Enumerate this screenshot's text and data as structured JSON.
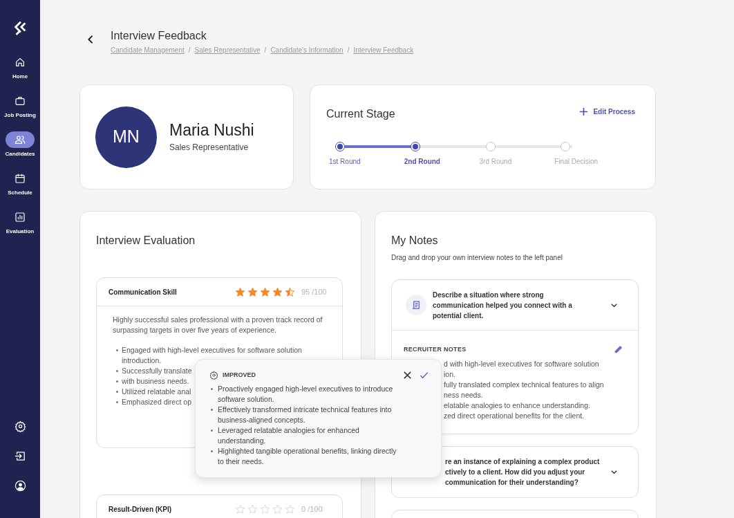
{
  "sidebar": {
    "items": [
      {
        "label": "Home",
        "selected": false
      },
      {
        "label": "Job Posting",
        "selected": false
      },
      {
        "label": "Candidates",
        "selected": true
      },
      {
        "label": "Schedule",
        "selected": false
      },
      {
        "label": "Evaluation",
        "selected": false
      }
    ]
  },
  "header": {
    "title": "Interview Feedback",
    "breadcrumb": [
      {
        "label": "Candidate Management",
        "separator": "/"
      },
      {
        "label": "Sales Representative",
        "separator": "/"
      },
      {
        "label": "Candidate's Information",
        "separator": "/"
      },
      {
        "label": "Interview Feedback"
      }
    ]
  },
  "candidate": {
    "initials": "MN",
    "name": "Maria Nushi",
    "role": "Sales Representative"
  },
  "stage": {
    "title": "Current Stage",
    "action": "Edit Process",
    "steps": [
      {
        "label": "1st Round",
        "reached": true,
        "selected": false
      },
      {
        "label": "2nd Round",
        "reached": true,
        "selected": true
      },
      {
        "label": "3rd Round",
        "reached": false,
        "selected": false
      },
      {
        "label": "Final Decision",
        "reached": false,
        "selected": false
      }
    ]
  },
  "evaluation": {
    "title": "Interview Evaluation",
    "criteria": [
      {
        "name": "Communication Skill",
        "stars": 4.5,
        "score": "95 /100",
        "summary": "Highly successful sales professional with a proven track record of surpassing targets in over five years of experience.",
        "bullets": [
          "Engaged with high-level executives for software solution introduction.",
          "Successfully translate",
          "with business needs.",
          "Utilized relatable anal",
          "Emphasized direct op"
        ]
      },
      {
        "name": "Result-Driven (KPI)",
        "stars": 0,
        "score": "0 /100"
      }
    ]
  },
  "popover": {
    "label": "IMPROVED",
    "bullets": [
      "Proactively engaged high-level executives to introduce software solution.",
      "Effectively transformed intricate technical features into business-aligned concepts.",
      "Leveraged relatable analogies for enhanced understanding.",
      "Highlighted tangible operational benefits, linking directly to their needs."
    ]
  },
  "notes": {
    "title": "My Notes",
    "subtitle": "Drag and drop your own interview notes to the left panel",
    "questions": [
      {
        "lines": [
          "Describe a situation where strong communication helped you connect with a potential client."
        ],
        "expanded": true,
        "notes_label": "RECRUITER NOTES",
        "notes": [
          "d with high-level executives for software solution",
          "ion.",
          "fully translated complex technical features to align",
          "ness needs.",
          "elatable analogies to enhance understanding.",
          "zed direct operational benefits for the client."
        ]
      },
      {
        "lines": [
          "re an instance of explaining a complex product",
          "ctively to a client. How did you adjust your",
          "communication for their understanding?"
        ],
        "expanded": false
      }
    ]
  }
}
